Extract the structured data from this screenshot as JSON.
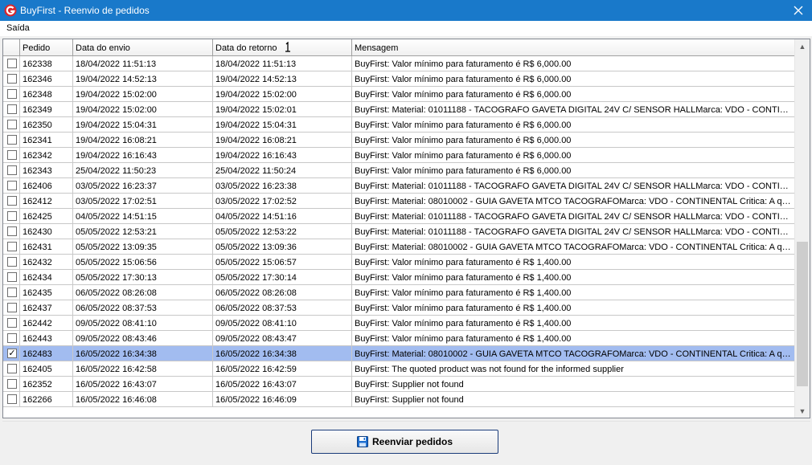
{
  "window": {
    "title": "BuyFirst - Reenvio de pedidos"
  },
  "menu": {
    "exit_label": "Saída"
  },
  "table": {
    "columns": [
      "Pedido",
      "Data do envio",
      "Data do retorno",
      "Mensagem"
    ],
    "sorted_column": "Data do retorno",
    "rows": [
      {
        "checked": false,
        "pedido": "162338",
        "envio": "18/04/2022 11:51:13",
        "retorno": "18/04/2022 11:51:13",
        "mensagem": "BuyFirst: Valor mínimo para faturamento é R$ 6,000.00"
      },
      {
        "checked": false,
        "pedido": "162346",
        "envio": "19/04/2022 14:52:13",
        "retorno": "19/04/2022 14:52:13",
        "mensagem": "BuyFirst: Valor mínimo para faturamento é R$ 6,000.00"
      },
      {
        "checked": false,
        "pedido": "162348",
        "envio": "19/04/2022 15:02:00",
        "retorno": "19/04/2022 15:02:00",
        "mensagem": "BuyFirst: Valor mínimo para faturamento é R$ 6,000.00"
      },
      {
        "checked": false,
        "pedido": "162349",
        "envio": "19/04/2022 15:02:00",
        "retorno": "19/04/2022 15:02:01",
        "mensagem": "BuyFirst: Material: 01011188 - TACOGRAFO GAVETA DIGITAL 24V C/ SENSOR HALLMarca: VDO - CONTINENTAL Critica: A quantidade"
      },
      {
        "checked": false,
        "pedido": "162350",
        "envio": "19/04/2022 15:04:31",
        "retorno": "19/04/2022 15:04:31",
        "mensagem": "BuyFirst: Valor mínimo para faturamento é R$ 6,000.00"
      },
      {
        "checked": false,
        "pedido": "162341",
        "envio": "19/04/2022 16:08:21",
        "retorno": "19/04/2022 16:08:21",
        "mensagem": "BuyFirst: Valor mínimo para faturamento é R$ 6,000.00"
      },
      {
        "checked": false,
        "pedido": "162342",
        "envio": "19/04/2022 16:16:43",
        "retorno": "19/04/2022 16:16:43",
        "mensagem": "BuyFirst: Valor mínimo para faturamento é R$ 6,000.00"
      },
      {
        "checked": false,
        "pedido": "162343",
        "envio": "25/04/2022 11:50:23",
        "retorno": "25/04/2022 11:50:24",
        "mensagem": "BuyFirst: Valor mínimo para faturamento é R$ 6,000.00"
      },
      {
        "checked": false,
        "pedido": "162406",
        "envio": "03/05/2022 16:23:37",
        "retorno": "03/05/2022 16:23:38",
        "mensagem": "BuyFirst: Material: 01011188 - TACOGRAFO GAVETA DIGITAL 24V C/ SENSOR HALLMarca: VDO - CONTINENTAL Critica: A quantidade"
      },
      {
        "checked": false,
        "pedido": "162412",
        "envio": "03/05/2022 17:02:51",
        "retorno": "03/05/2022 17:02:52",
        "mensagem": "BuyFirst: Material: 08010002 - GUIA GAVETA MTCO TACOGRAFOMarca: VDO - CONTINENTAL Critica: A quantidade"
      },
      {
        "checked": false,
        "pedido": "162425",
        "envio": "04/05/2022 14:51:15",
        "retorno": "04/05/2022 14:51:16",
        "mensagem": "BuyFirst: Material: 01011188 - TACOGRAFO GAVETA DIGITAL 24V C/ SENSOR HALLMarca: VDO - CONTINENTAL Critica: A quantidade"
      },
      {
        "checked": false,
        "pedido": "162430",
        "envio": "05/05/2022 12:53:21",
        "retorno": "05/05/2022 12:53:22",
        "mensagem": "BuyFirst: Material: 01011188 - TACOGRAFO GAVETA DIGITAL 24V C/ SENSOR HALLMarca: VDO - CONTINENTAL Critica: A quantidade"
      },
      {
        "checked": false,
        "pedido": "162431",
        "envio": "05/05/2022 13:09:35",
        "retorno": "05/05/2022 13:09:36",
        "mensagem": "BuyFirst: Material: 08010002 - GUIA GAVETA MTCO TACOGRAFOMarca: VDO - CONTINENTAL Critica: A quantidade"
      },
      {
        "checked": false,
        "pedido": "162432",
        "envio": "05/05/2022 15:06:56",
        "retorno": "05/05/2022 15:06:57",
        "mensagem": "BuyFirst: Valor mínimo para faturamento é R$ 1,400.00"
      },
      {
        "checked": false,
        "pedido": "162434",
        "envio": "05/05/2022 17:30:13",
        "retorno": "05/05/2022 17:30:14",
        "mensagem": "BuyFirst: Valor mínimo para faturamento é R$ 1,400.00"
      },
      {
        "checked": false,
        "pedido": "162435",
        "envio": "06/05/2022 08:26:08",
        "retorno": "06/05/2022 08:26:08",
        "mensagem": "BuyFirst: Valor mínimo para faturamento é R$ 1,400.00"
      },
      {
        "checked": false,
        "pedido": "162437",
        "envio": "06/05/2022 08:37:53",
        "retorno": "06/05/2022 08:37:53",
        "mensagem": "BuyFirst: Valor mínimo para faturamento é R$ 1,400.00"
      },
      {
        "checked": false,
        "pedido": "162442",
        "envio": "09/05/2022 08:41:10",
        "retorno": "09/05/2022 08:41:10",
        "mensagem": "BuyFirst: Valor mínimo para faturamento é R$ 1,400.00"
      },
      {
        "checked": false,
        "pedido": "162443",
        "envio": "09/05/2022 08:43:46",
        "retorno": "09/05/2022 08:43:47",
        "mensagem": "BuyFirst: Valor mínimo para faturamento é R$ 1,400.00"
      },
      {
        "checked": true,
        "pedido": "162483",
        "envio": "16/05/2022 16:34:38",
        "retorno": "16/05/2022 16:34:38",
        "mensagem": "BuyFirst: Material: 08010002 - GUIA GAVETA MTCO TACOGRAFOMarca: VDO - CONTINENTAL Critica: A quantidade"
      },
      {
        "checked": false,
        "pedido": "162405",
        "envio": "16/05/2022 16:42:58",
        "retorno": "16/05/2022 16:42:59",
        "mensagem": "BuyFirst: The quoted product was not found for the informed supplier"
      },
      {
        "checked": false,
        "pedido": "162352",
        "envio": "16/05/2022 16:43:07",
        "retorno": "16/05/2022 16:43:07",
        "mensagem": "BuyFirst: Supplier not found"
      },
      {
        "checked": false,
        "pedido": "162266",
        "envio": "16/05/2022 16:46:08",
        "retorno": "16/05/2022 16:46:09",
        "mensagem": "BuyFirst: Supplier not found"
      }
    ]
  },
  "footer": {
    "resend_label": "Reenviar pedidos"
  },
  "colors": {
    "titlebar": "#1979ca",
    "selected_row": "#a2bcf0",
    "accent_red": "#d9262c"
  }
}
